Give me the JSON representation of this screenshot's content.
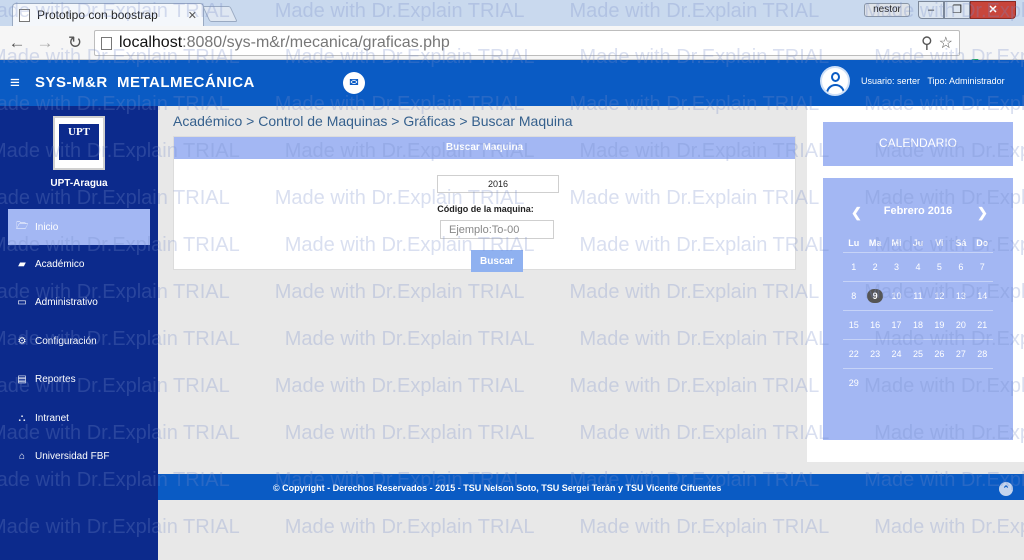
{
  "browser": {
    "tab_title": "Prototipo con boostrap",
    "window_user": "nestor",
    "url_host": "localhost",
    "url_path": ":8080/sys-m&r/mecanica/graficas.php"
  },
  "navbar": {
    "brand": "SYS-M&R  METALMECÁNICA",
    "user_label": "Usuario: serter",
    "role_label": "Tipo: Administrador"
  },
  "sidebar": {
    "org_name": "UPT-Aragua",
    "logo_text": "UPT",
    "items": [
      {
        "label": "Inicio",
        "icon": "folder-open-icon"
      },
      {
        "label": "Académico",
        "icon": "book-icon"
      },
      {
        "label": "Administrativo",
        "icon": "monitor-icon"
      },
      {
        "label": "Configuración",
        "icon": "gears-icon"
      },
      {
        "label": "Reportes",
        "icon": "document-icon"
      },
      {
        "label": "Intranet",
        "icon": "sitemap-icon"
      },
      {
        "label": "Universidad FBF",
        "icon": "bank-icon"
      }
    ]
  },
  "breadcrumb": {
    "text": "Académico > Control de Maquinas > Gráficas > Buscar Maquina"
  },
  "search_panel": {
    "title": "Buscar Maquina",
    "year_value": "2016",
    "code_label": "Código de la maquina:",
    "code_placeholder": "Ejemplo:To-00",
    "search_button": "Buscar"
  },
  "calendar": {
    "header": "CALENDARIO",
    "month_label": "Febrero 2016",
    "weekdays": [
      "Lu",
      "Ma",
      "Mi",
      "Ju",
      "Vi",
      "Sá",
      "Do"
    ],
    "weeks": [
      [
        "1",
        "2",
        "3",
        "4",
        "5",
        "6",
        "7"
      ],
      [
        "8",
        "9",
        "10",
        "11",
        "12",
        "13",
        "14"
      ],
      [
        "15",
        "16",
        "17",
        "18",
        "19",
        "20",
        "21"
      ],
      [
        "22",
        "23",
        "24",
        "25",
        "26",
        "27",
        "28"
      ],
      [
        "29",
        "",
        "",
        "",
        "",
        "",
        ""
      ]
    ],
    "today": "9"
  },
  "footer": {
    "copyright": "© Copyright - Derechos Reservados - 2015 - TSU Nelson Soto, TSU Sergei Terán y TSU Vicente Cifuentes"
  },
  "watermark": {
    "text": "Made with Dr.Explain TRIAL"
  },
  "colors": {
    "navbar": "#0a5bc4",
    "sidebar": "#0c2a8c",
    "accent_light": "#a3b7f3"
  }
}
